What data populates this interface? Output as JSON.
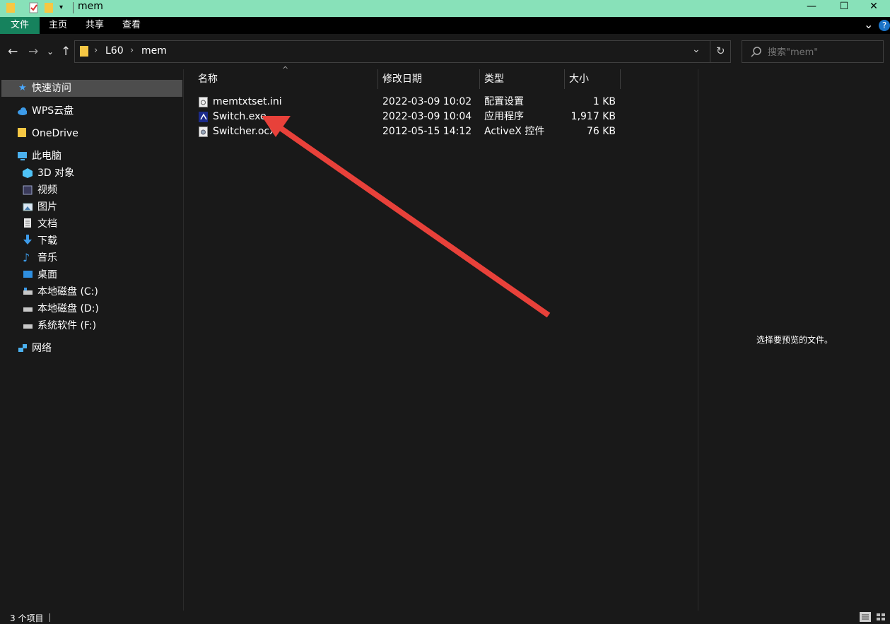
{
  "window": {
    "title": "mem",
    "minimize_glyph": "—",
    "maximize_glyph": "☐",
    "close_glyph": "✕"
  },
  "ribbon": {
    "tabs": [
      {
        "label": "文件"
      },
      {
        "label": "主页"
      },
      {
        "label": "共享"
      },
      {
        "label": "查看"
      }
    ],
    "accent_color": "#16825d",
    "collapse_glyph": "⌄",
    "help_glyph": "?"
  },
  "nav": {
    "back_glyph": "←",
    "forward_glyph": "→",
    "recent_glyph": "⌄",
    "up_glyph": "↑",
    "breadcrumb": [
      "L60",
      "mem"
    ],
    "dropdown_glyph": "⌄",
    "refresh_glyph": "↻"
  },
  "search": {
    "placeholder": "搜索\"mem\""
  },
  "sidebar": {
    "items": [
      {
        "label": "快速访问",
        "icon": "star-icon"
      },
      {
        "label": "WPS云盘",
        "icon": "cloud-icon"
      },
      {
        "label": "OneDrive",
        "icon": "folder-icon"
      },
      {
        "label": "此电脑",
        "icon": "computer-icon"
      },
      {
        "label": "3D 对象",
        "icon": "cube-icon"
      },
      {
        "label": "视频",
        "icon": "video-icon"
      },
      {
        "label": "图片",
        "icon": "picture-icon"
      },
      {
        "label": "文档",
        "icon": "document-icon"
      },
      {
        "label": "下载",
        "icon": "download-icon"
      },
      {
        "label": "音乐",
        "icon": "music-icon"
      },
      {
        "label": "桌面",
        "icon": "desktop-icon"
      },
      {
        "label": "本地磁盘 (C:)",
        "icon": "drive-icon"
      },
      {
        "label": "本地磁盘 (D:)",
        "icon": "drive-icon"
      },
      {
        "label": "系统软件 (F:)",
        "icon": "drive-icon"
      },
      {
        "label": "网络",
        "icon": "network-icon"
      }
    ]
  },
  "columns": [
    "名称",
    "修改日期",
    "类型",
    "大小"
  ],
  "sort_glyph": "^",
  "files": [
    {
      "name": "memtxtset.ini",
      "date": "2022-03-09 10:02",
      "type": "配置设置",
      "size": "1 KB",
      "icon": "ini-file-icon"
    },
    {
      "name": "Switch.exe",
      "date": "2022-03-09 10:04",
      "type": "应用程序",
      "size": "1,917 KB",
      "icon": "exe-file-icon"
    },
    {
      "name": "Switcher.ocx",
      "date": "2012-05-15 14:12",
      "type": "ActiveX 控件",
      "size": "76 KB",
      "icon": "ocx-file-icon"
    }
  ],
  "preview": {
    "message": "选择要预览的文件。"
  },
  "status": {
    "item_count": "3 个项目"
  },
  "annotation": {
    "arrow_color": "#e8413a"
  }
}
